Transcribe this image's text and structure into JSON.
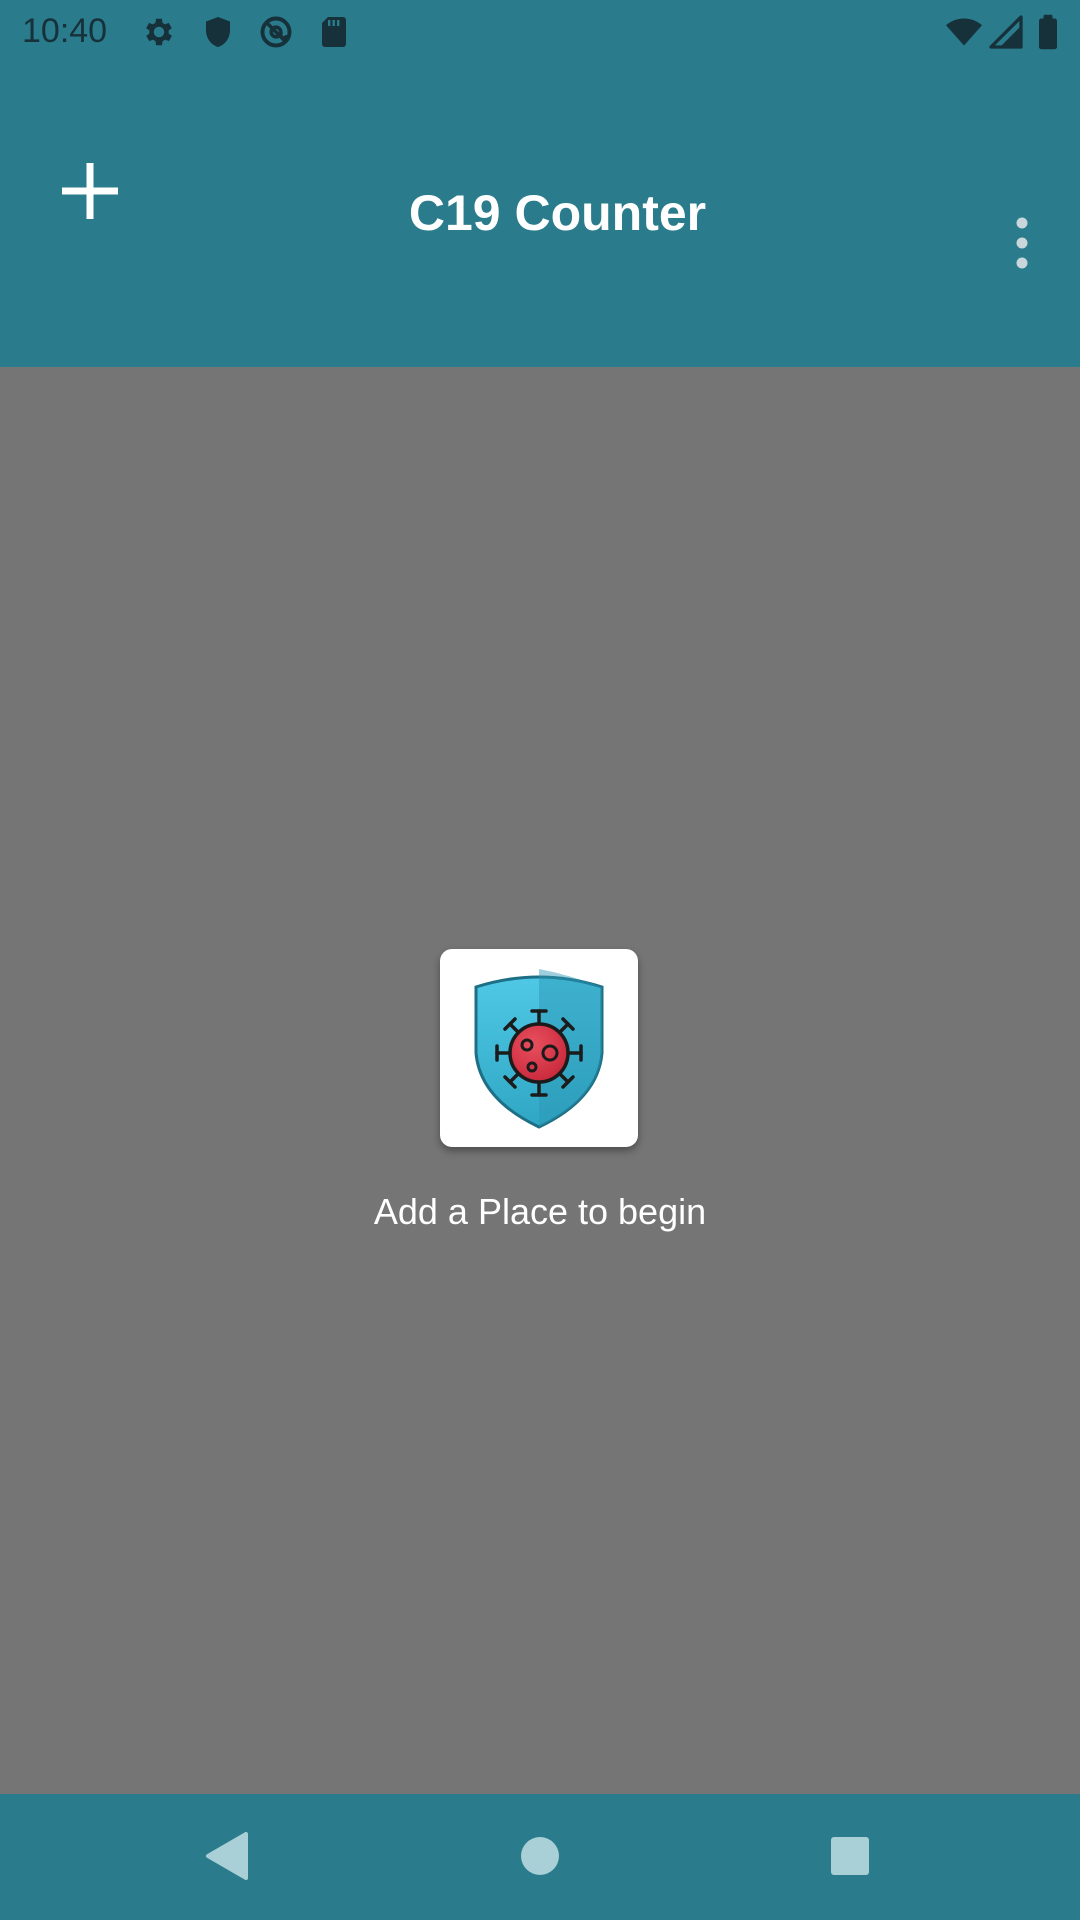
{
  "status_bar": {
    "time": "10:40",
    "left_icons": [
      "gear-icon",
      "shield-icon",
      "at-sign-icon",
      "sd-card-icon"
    ],
    "right_icons": [
      "wifi-icon",
      "cell-signal-icon",
      "battery-icon"
    ]
  },
  "app_bar": {
    "title": "C19 Counter",
    "add_icon": "plus-icon",
    "overflow_icon": "more-vertical-icon",
    "background_color": "#2a7b8c"
  },
  "main": {
    "empty_state_icon": "virus-shield-icon",
    "empty_state_text": "Add a Place to begin",
    "background_color": "#757575"
  },
  "nav_bar": {
    "buttons": [
      "back-icon",
      "home-icon",
      "recents-icon"
    ]
  }
}
